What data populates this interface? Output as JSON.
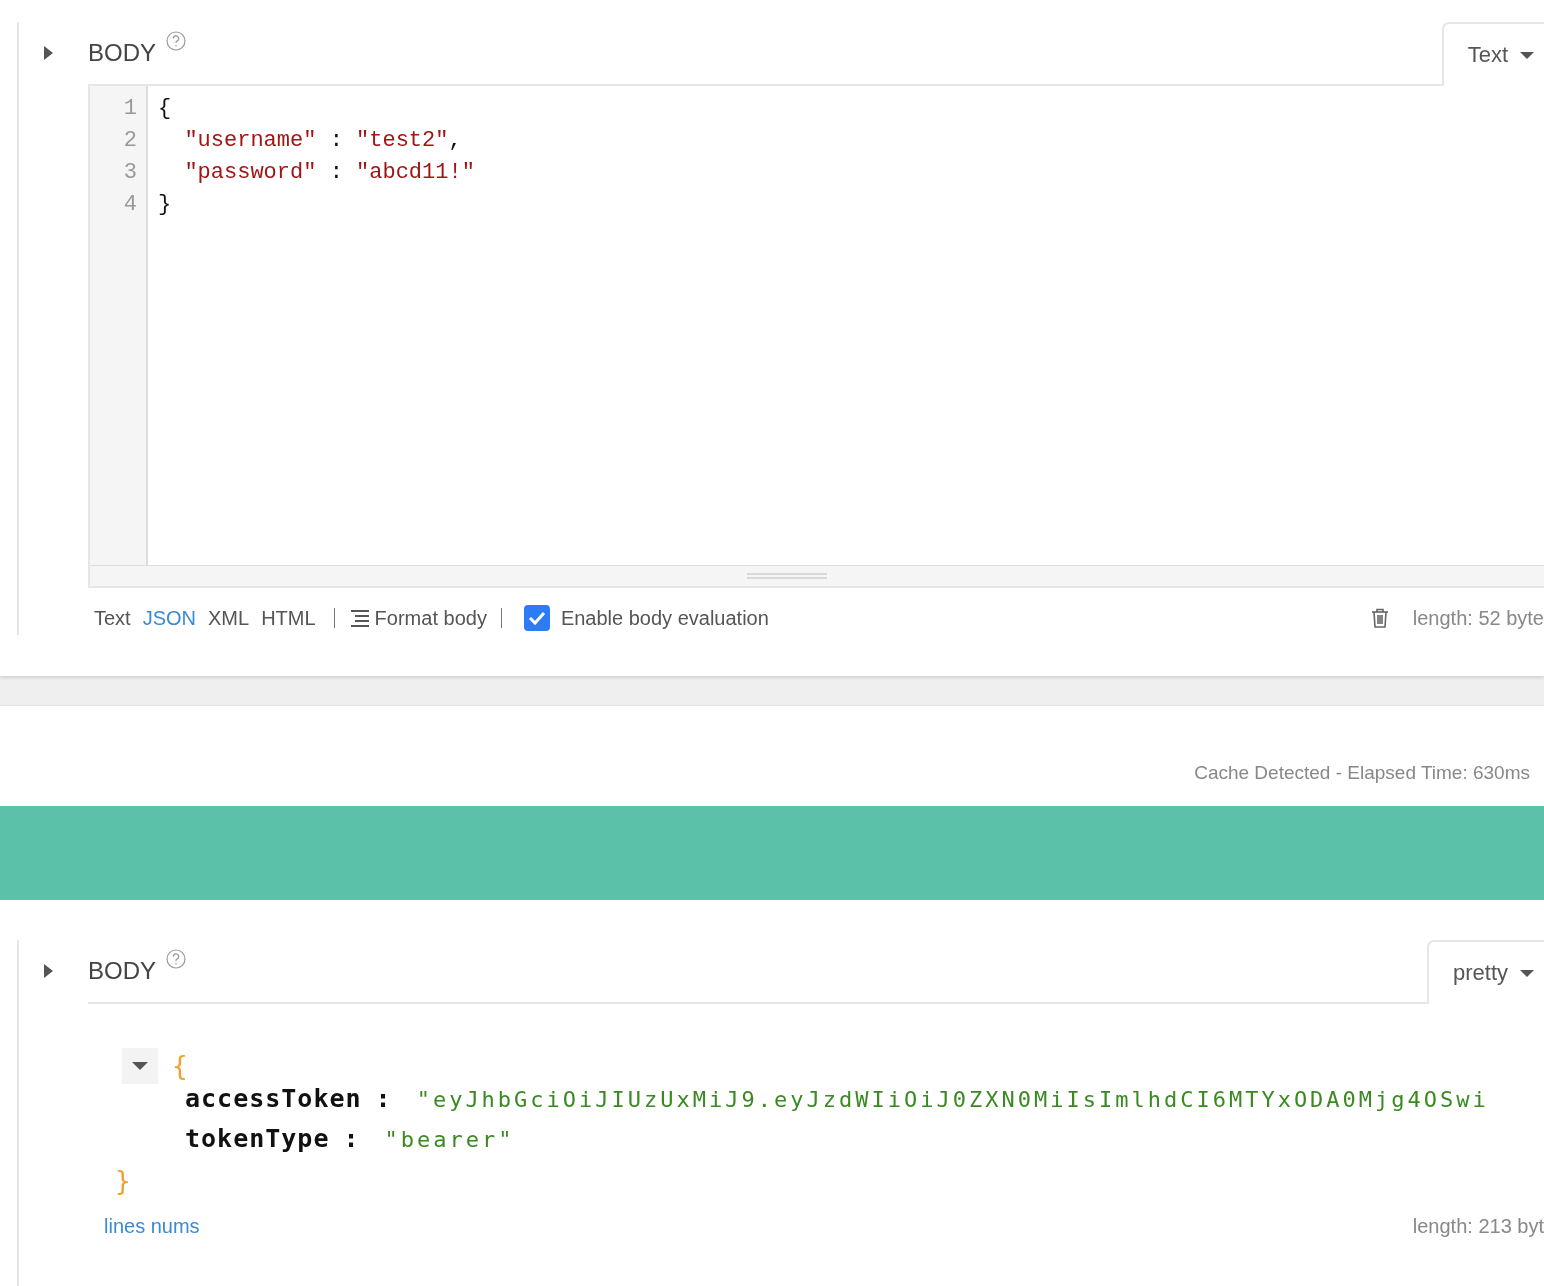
{
  "request": {
    "title": "BODY",
    "format_dropdown": "Text",
    "editor": {
      "lines": [
        {
          "number": "1",
          "tokens": [
            {
              "kind": "punct",
              "text": "{"
            }
          ]
        },
        {
          "number": "2",
          "tokens": [
            {
              "kind": "string",
              "text": "  \"username\""
            },
            {
              "kind": "punct",
              "text": " : "
            },
            {
              "kind": "string",
              "text": "\"test2\""
            },
            {
              "kind": "punct",
              "text": ","
            }
          ]
        },
        {
          "number": "3",
          "tokens": [
            {
              "kind": "string",
              "text": "  \"password\""
            },
            {
              "kind": "punct",
              "text": " : "
            },
            {
              "kind": "string",
              "text": "\"abcd11!\""
            }
          ]
        },
        {
          "number": "4",
          "tokens": [
            {
              "kind": "punct",
              "text": "}"
            }
          ]
        }
      ]
    },
    "footer": {
      "formats": [
        {
          "label": "Text",
          "selected": false
        },
        {
          "label": "JSON",
          "selected": true
        },
        {
          "label": "XML",
          "selected": false
        },
        {
          "label": "HTML",
          "selected": false
        }
      ],
      "format_body": "Format body",
      "evaluation": {
        "label": "Enable body evaluation",
        "checked": true
      },
      "length": "length: 52 byte"
    }
  },
  "status": "Cache Detected - Elapsed Time: 630ms",
  "response": {
    "title": "BODY",
    "view_dropdown": "pretty",
    "tree": {
      "open": "{",
      "expanded": true,
      "entries": [
        {
          "key": "accessToken",
          "separator": ":",
          "value": "\"eyJhbGciOiJIUzUxMiJ9.eyJzdWIiOiJ0ZXN0MiIsImlhdCI6MTYxODA0Mjg4OSwi"
        },
        {
          "key": "tokenType",
          "separator": ":",
          "value": "\"bearer\""
        }
      ],
      "close": "}"
    },
    "lines_link": "lines nums",
    "length": "length: 213 byt"
  }
}
